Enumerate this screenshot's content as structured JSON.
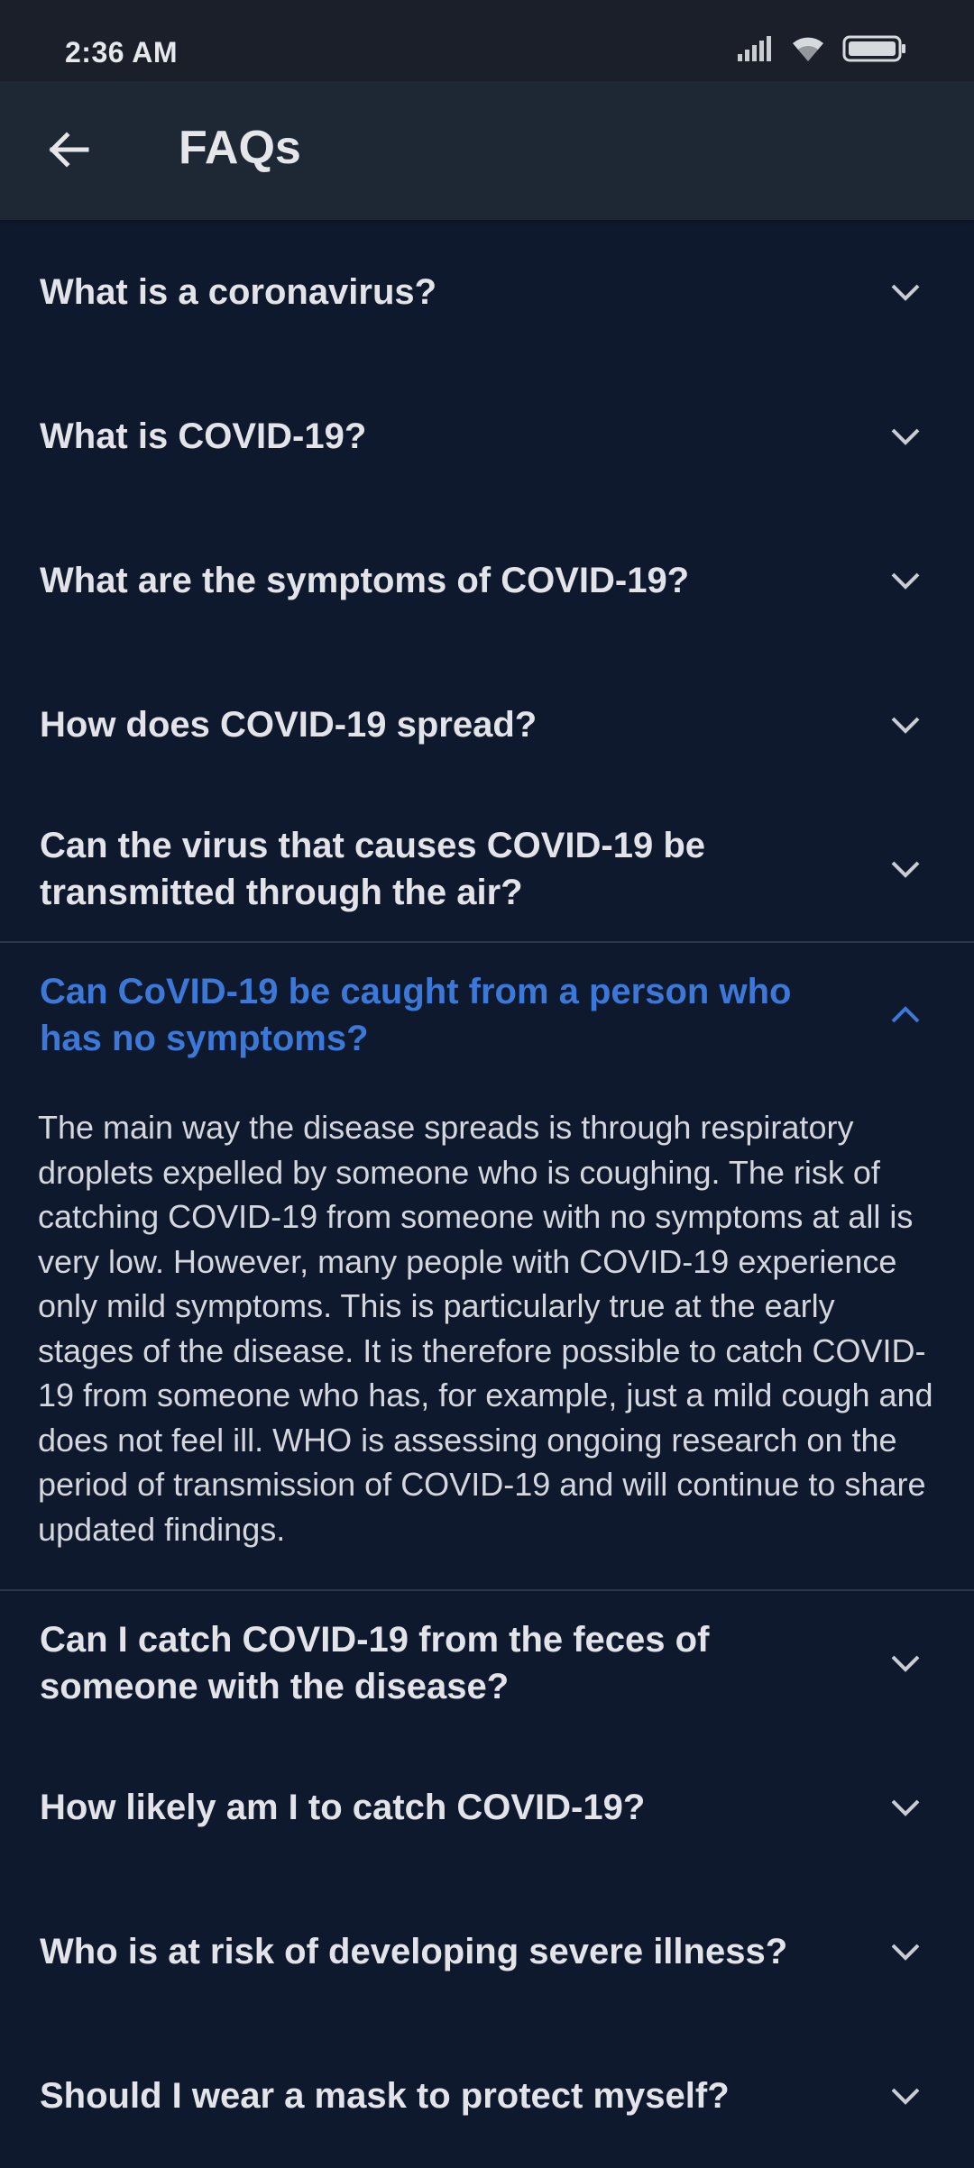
{
  "status_bar": {
    "time": "2:36 AM",
    "icons": [
      "signal-icon",
      "wifi-icon",
      "battery-icon"
    ]
  },
  "app_bar": {
    "title": "FAQs",
    "back_icon": "arrow-left-icon"
  },
  "colors": {
    "background": "#0f192d",
    "app_bar": "#1e2734",
    "expanded_question": "#3c78d8",
    "text": "#e2e4e9"
  },
  "faqs": [
    {
      "question": "What is a coronavirus?",
      "expanded": false
    },
    {
      "question": "What is COVID-19?",
      "expanded": false
    },
    {
      "question": "What are the symptoms of COVID-19?",
      "expanded": false
    },
    {
      "question": "How does COVID-19 spread?",
      "expanded": false
    },
    {
      "question": "Can the virus that causes COVID-19 be transmitted through the air?",
      "expanded": false
    },
    {
      "question": "Can CoVID-19 be caught from a person who has no symptoms?",
      "expanded": true,
      "answer": "The main way the disease spreads is through respiratory droplets expelled by someone who is coughing. The risk of catching COVID-19 from someone with no symptoms at all is very low. However, many people with COVID-19 experience only mild symptoms. This is particularly true at the early stages of the disease. It is therefore possible to catch COVID-19 from someone who has, for example, just a mild cough and does not feel ill.  WHO is assessing ongoing research on the period of transmission of COVID-19 and will continue to share updated findings."
    },
    {
      "question": "Can I catch COVID-19 from the feces of someone with the disease?",
      "expanded": false
    },
    {
      "question": "How likely am I to catch COVID-19?",
      "expanded": false
    },
    {
      "question": "Who is at risk of developing severe illness?",
      "expanded": false
    },
    {
      "question": "Should I wear a mask to protect myself?",
      "expanded": false
    }
  ]
}
